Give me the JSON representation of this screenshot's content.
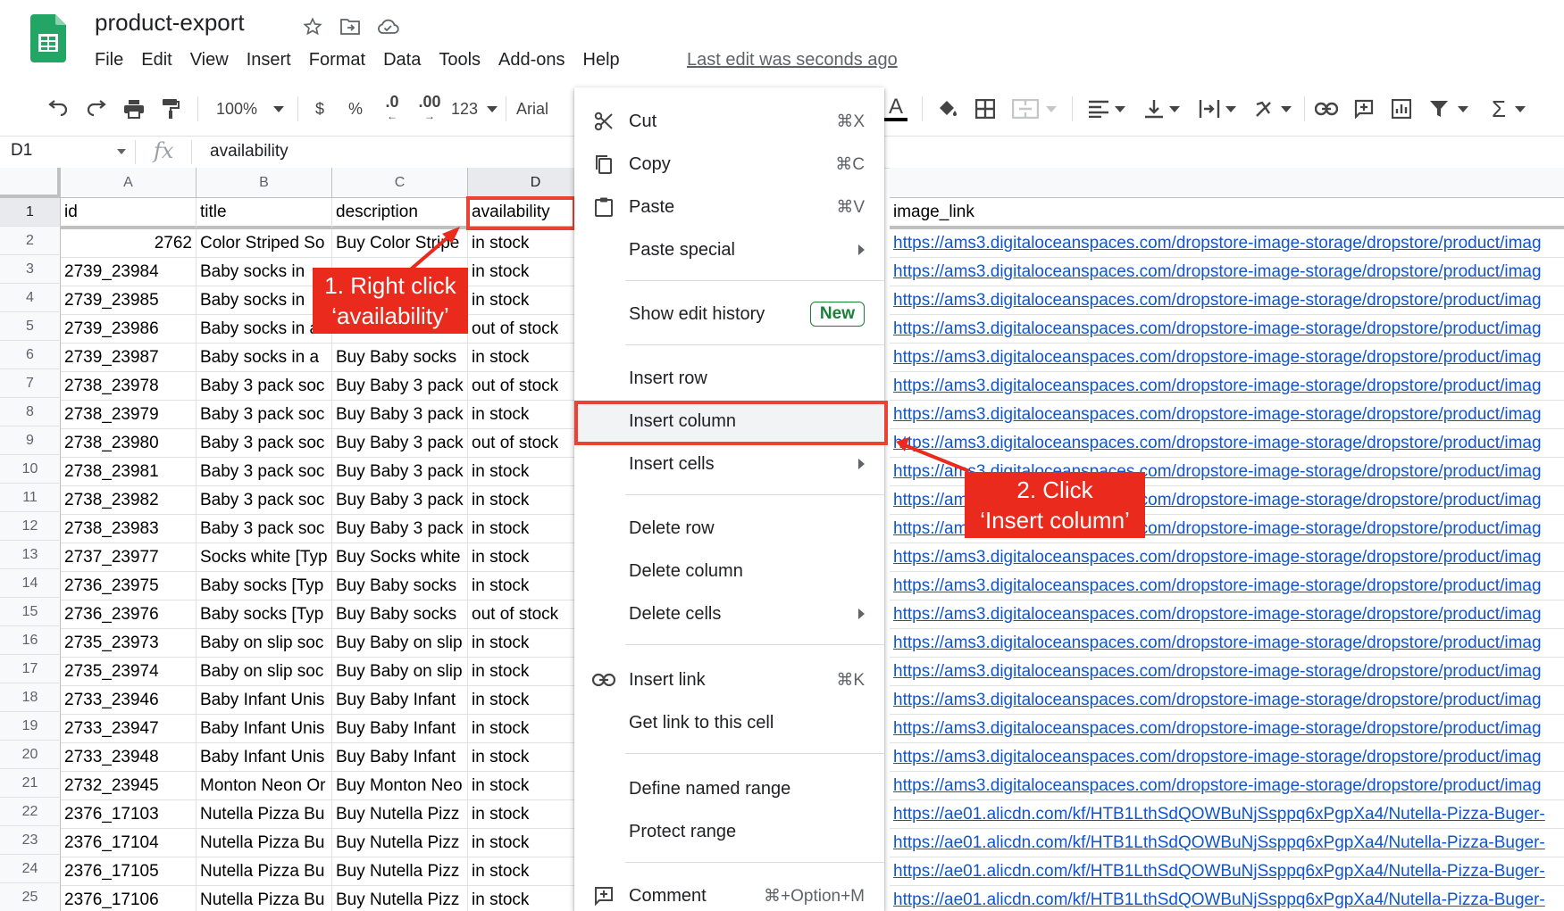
{
  "header": {
    "doc_title": "product-export",
    "menu": [
      "File",
      "Edit",
      "View",
      "Insert",
      "Format",
      "Data",
      "Tools",
      "Add-ons",
      "Help"
    ],
    "last_edit": "Last edit was seconds ago"
  },
  "toolbar": {
    "zoom": "100%",
    "currency": "$",
    "percent": "%",
    "dec_less": ".0",
    "dec_more": ".00",
    "more_formats": "123",
    "font": "Arial"
  },
  "formula_bar": {
    "name_box": "D1",
    "fx": "fx",
    "value": "availability"
  },
  "grid": {
    "columns": [
      "A",
      "B",
      "C",
      "D"
    ],
    "header_row": [
      "id",
      "title",
      "description",
      "availability",
      "image_link"
    ],
    "row_numbers": [
      "1",
      "2",
      "3",
      "4",
      "5",
      "6",
      "7",
      "8",
      "9",
      "10",
      "11",
      "12",
      "13",
      "14",
      "15",
      "16",
      "17",
      "18",
      "19",
      "20",
      "21",
      "22",
      "23",
      "24",
      "25"
    ],
    "rows": [
      [
        "2762",
        "Color Striped So",
        "Buy Color Stripe",
        "in stock",
        "https://ams3.digitaloceanspaces.com/dropstore-image-storage/dropstore/product/imag"
      ],
      [
        "2739_23984",
        "Baby socks in",
        "",
        "in stock",
        "https://ams3.digitaloceanspaces.com/dropstore-image-storage/dropstore/product/imag"
      ],
      [
        "2739_23985",
        "Baby socks in",
        "",
        "in stock",
        "https://ams3.digitaloceanspaces.com/dropstore-image-storage/dropstore/product/imag"
      ],
      [
        "2739_23986",
        "Baby socks in a",
        "",
        "out of stock",
        "https://ams3.digitaloceanspaces.com/dropstore-image-storage/dropstore/product/imag"
      ],
      [
        "2739_23987",
        "Baby socks in a",
        "Buy Baby socks",
        "in stock",
        "https://ams3.digitaloceanspaces.com/dropstore-image-storage/dropstore/product/imag"
      ],
      [
        "2738_23978",
        "Baby 3 pack soc",
        "Buy Baby 3 pack",
        "out of stock",
        "https://ams3.digitaloceanspaces.com/dropstore-image-storage/dropstore/product/imag"
      ],
      [
        "2738_23979",
        "Baby 3 pack soc",
        "Buy Baby 3 pack",
        "in stock",
        "https://ams3.digitaloceanspaces.com/dropstore-image-storage/dropstore/product/imag"
      ],
      [
        "2738_23980",
        "Baby 3 pack soc",
        "Buy Baby 3 pack",
        "out of stock",
        "https://ams3.digitaloceanspaces.com/dropstore-image-storage/dropstore/product/imag"
      ],
      [
        "2738_23981",
        "Baby 3 pack soc",
        "Buy Baby 3 pack",
        "in stock",
        "https://ams3.digitaloceanspaces.com/dropstore-image-storage/dropstore/product/imag"
      ],
      [
        "2738_23982",
        "Baby 3 pack soc",
        "Buy Baby 3 pack",
        "in stock",
        "https://ams3.digitaloceanspaces.com/dropstore-image-storage/dropstore/product/imag"
      ],
      [
        "2738_23983",
        "Baby 3 pack soc",
        "Buy Baby 3 pack",
        "in stock",
        "https://ams3.digitaloceanspaces.com/dropstore-image-storage/dropstore/product/imag"
      ],
      [
        "2737_23977",
        "Socks white [Typ",
        "Buy Socks white",
        "in stock",
        "https://ams3.digitaloceanspaces.com/dropstore-image-storage/dropstore/product/imag"
      ],
      [
        "2736_23975",
        "Baby socks [Typ",
        "Buy Baby socks",
        "in stock",
        "https://ams3.digitaloceanspaces.com/dropstore-image-storage/dropstore/product/imag"
      ],
      [
        "2736_23976",
        "Baby socks [Typ",
        "Buy Baby socks",
        "out of stock",
        "https://ams3.digitaloceanspaces.com/dropstore-image-storage/dropstore/product/imag"
      ],
      [
        "2735_23973",
        "Baby on slip soc",
        "Buy Baby on slip",
        "in stock",
        "https://ams3.digitaloceanspaces.com/dropstore-image-storage/dropstore/product/imag"
      ],
      [
        "2735_23974",
        "Baby on slip soc",
        "Buy Baby on slip",
        "in stock",
        "https://ams3.digitaloceanspaces.com/dropstore-image-storage/dropstore/product/imag"
      ],
      [
        "2733_23946",
        "Baby Infant Unis",
        "Buy Baby Infant",
        "in stock",
        "https://ams3.digitaloceanspaces.com/dropstore-image-storage/dropstore/product/imag"
      ],
      [
        "2733_23947",
        "Baby Infant Unis",
        "Buy Baby Infant",
        "in stock",
        "https://ams3.digitaloceanspaces.com/dropstore-image-storage/dropstore/product/imag"
      ],
      [
        "2733_23948",
        "Baby Infant Unis",
        "Buy Baby Infant",
        "in stock",
        "https://ams3.digitaloceanspaces.com/dropstore-image-storage/dropstore/product/imag"
      ],
      [
        "2732_23945",
        "Monton Neon Or",
        "Buy Monton Neo",
        "in stock",
        "https://ams3.digitaloceanspaces.com/dropstore-image-storage/dropstore/product/imag"
      ],
      [
        "2376_17103",
        "Nutella Pizza Bu",
        "Buy Nutella Pizz",
        "in stock",
        "https://ae01.alicdn.com/kf/HTB1LthSdQOWBuNjSsppq6xPgpXa4/Nutella-Pizza-Buger-"
      ],
      [
        "2376_17104",
        "Nutella Pizza Bu",
        "Buy Nutella Pizz",
        "in stock",
        "https://ae01.alicdn.com/kf/HTB1LthSdQOWBuNjSsppq6xPgpXa4/Nutella-Pizza-Buger-"
      ],
      [
        "2376_17105",
        "Nutella Pizza Bu",
        "Buy Nutella Pizz",
        "in stock",
        "https://ae01.alicdn.com/kf/HTB1LthSdQOWBuNjSsppq6xPgpXa4/Nutella-Pizza-Buger-"
      ],
      [
        "2376_17106",
        "Nutella Pizza Bu",
        "Buy Nutella Pizz",
        "in stock",
        "https://ae01.alicdn.com/kf/HTB1LthSdQOWBuNjSsppq6xPgpXa4/Nutella-Pizza-Buger-"
      ]
    ]
  },
  "context_menu": {
    "cut": "Cut",
    "cut_sc": "⌘X",
    "copy": "Copy",
    "copy_sc": "⌘C",
    "paste": "Paste",
    "paste_sc": "⌘V",
    "paste_special": "Paste special",
    "show_edit_history": "Show edit history",
    "new_badge": "New",
    "insert_row": "Insert row",
    "insert_column": "Insert column",
    "insert_cells": "Insert cells",
    "delete_row": "Delete row",
    "delete_column": "Delete column",
    "delete_cells": "Delete cells",
    "insert_link": "Insert link",
    "insert_link_sc": "⌘K",
    "get_link": "Get link to this cell",
    "define_named_range": "Define named range",
    "protect_range": "Protect range",
    "comment": "Comment",
    "comment_sc": "⌘+Option+M"
  },
  "annotations": {
    "step1": [
      "1. Right click",
      "‘availability’"
    ],
    "step2": [
      "2. Click",
      "‘Insert column’"
    ],
    "accent": "#ea2a1d"
  }
}
